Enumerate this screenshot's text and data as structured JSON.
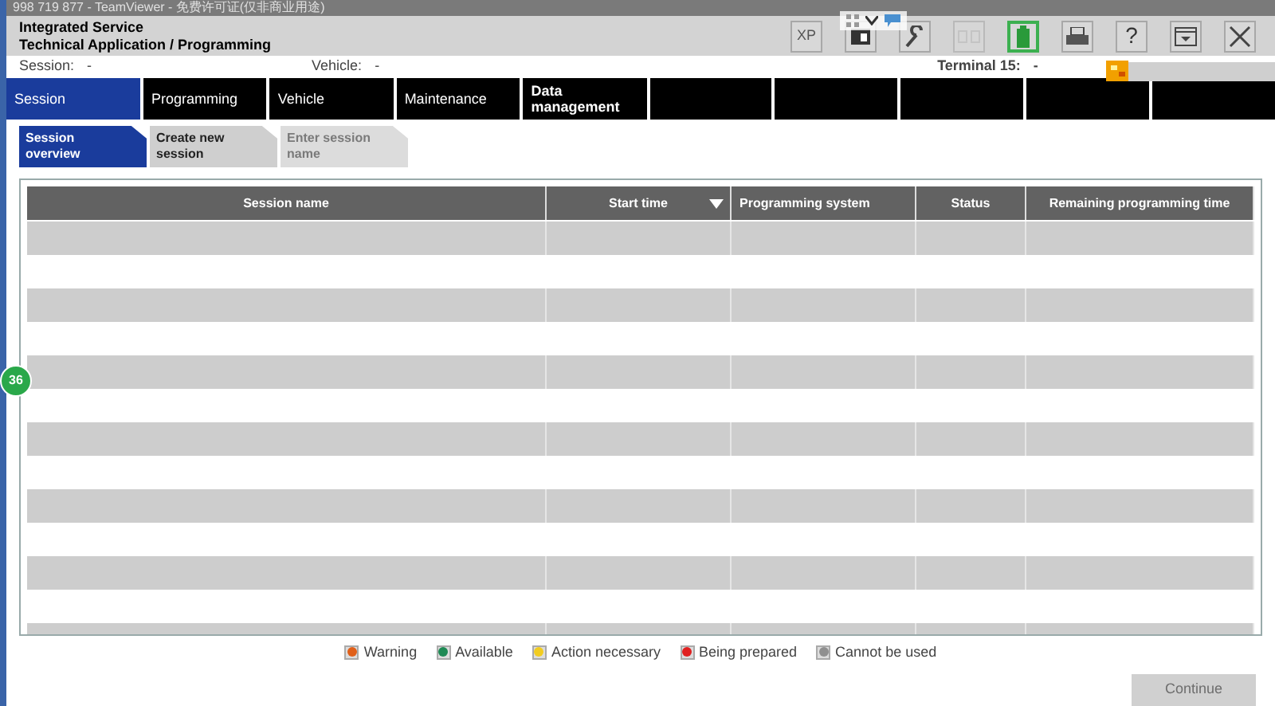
{
  "window": {
    "title": "998 719 877 - TeamViewer - 免费许可证(仅非商业用途)"
  },
  "header": {
    "line_1": "Integrated Service",
    "line_2": "Technical Application / Programming"
  },
  "toolbar": [
    {
      "kind": "text",
      "label": "XP",
      "disabled": false,
      "highlighted": false
    },
    {
      "kind": "save",
      "disabled": false,
      "highlighted": false
    },
    {
      "kind": "wrench",
      "disabled": false,
      "highlighted": false
    },
    {
      "kind": "dual",
      "disabled": true,
      "highlighted": false
    },
    {
      "kind": "battery",
      "disabled": false,
      "highlighted": true
    },
    {
      "kind": "printer",
      "disabled": false,
      "highlighted": false
    },
    {
      "kind": "text",
      "label": "?",
      "disabled": false,
      "highlighted": false
    },
    {
      "kind": "dropdown",
      "disabled": false,
      "highlighted": false
    },
    {
      "kind": "close",
      "disabled": false,
      "highlighted": false
    }
  ],
  "info": {
    "session_label": "Session:",
    "session_value": "-",
    "vehicle_label": "Vehicle:",
    "vehicle_value": "-",
    "terminal_label": "Terminal 15:",
    "terminal_value": "-"
  },
  "nav_tabs": [
    {
      "label": "Session",
      "selected": true
    },
    {
      "label": "Programming",
      "selected": false
    },
    {
      "label": "Vehicle",
      "selected": false
    },
    {
      "label": "Maintenance",
      "selected": false
    },
    {
      "label": "Data management",
      "selected": false
    }
  ],
  "sub_tabs": [
    {
      "label": "Session overview",
      "selected": true,
      "disabled": false
    },
    {
      "label": "Create new session",
      "selected": false,
      "disabled": false
    },
    {
      "label": "Enter session name",
      "selected": false,
      "disabled": true
    }
  ],
  "table": {
    "columns": [
      {
        "label": "Session name",
        "sorted": false
      },
      {
        "label": "Start time",
        "sorted": true
      },
      {
        "label": "Programming system",
        "sorted": false
      },
      {
        "label": "Status",
        "sorted": false
      },
      {
        "label": "Remaining programming time",
        "sorted": false
      }
    ]
  },
  "legend": [
    {
      "label": "Warning",
      "color": "#e0601a"
    },
    {
      "label": "Available",
      "color": "#1f8a55"
    },
    {
      "label": "Action necessary",
      "color": "#f2cc20"
    },
    {
      "label": "Being prepared",
      "color": "#e02020"
    },
    {
      "label": "Cannot be used",
      "color": "#909090"
    }
  ],
  "continue_button": {
    "label": "Continue",
    "disabled": true
  },
  "remote_badge": "36"
}
